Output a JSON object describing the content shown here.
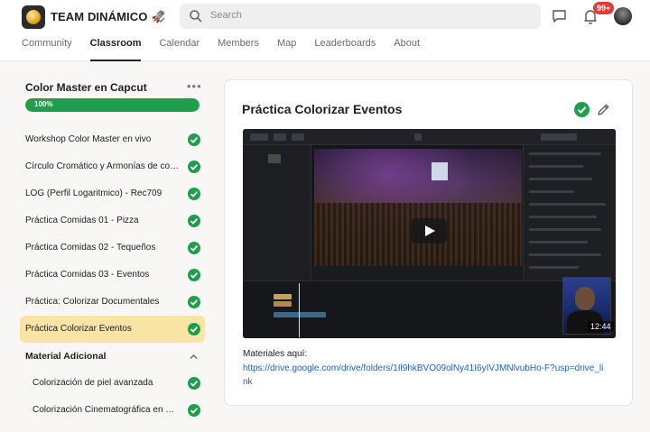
{
  "header": {
    "team_name": "TEAM DINÁMICO",
    "team_emoji": "🚀",
    "search_placeholder": "Search",
    "notification_count": "99+",
    "tabs": [
      {
        "label": "Community",
        "active": false
      },
      {
        "label": "Classroom",
        "active": true
      },
      {
        "label": "Calendar",
        "active": false
      },
      {
        "label": "Members",
        "active": false
      },
      {
        "label": "Map",
        "active": false
      },
      {
        "label": "Leaderboards",
        "active": false
      },
      {
        "label": "About",
        "active": false
      }
    ]
  },
  "sidebar": {
    "course_title": "Color Master en Capcut",
    "progress": 100,
    "progress_label": "100%",
    "lessons": [
      {
        "label": "Workshop Color Master en vivo",
        "completed": true,
        "active": false
      },
      {
        "label": "Círculo Cromático y Armonías de colores",
        "completed": true,
        "active": false
      },
      {
        "label": "LOG (Perfil Logaritmico) - Rec709",
        "completed": true,
        "active": false
      },
      {
        "label": "Práctica Comidas 01 - Pizza",
        "completed": true,
        "active": false
      },
      {
        "label": "Práctica Comidas 02 - Tequeños",
        "completed": true,
        "active": false
      },
      {
        "label": "Práctica Comidas 03 - Eventos",
        "completed": true,
        "active": false
      },
      {
        "label": "Práctica: Colorizar Documentales",
        "completed": true,
        "active": false
      },
      {
        "label": "Práctica Colorizar Eventos",
        "completed": true,
        "active": true
      }
    ],
    "section": {
      "title": "Material Adicional",
      "expanded": true,
      "lessons": [
        {
          "label": "Colorización de piel avanzada",
          "completed": true
        },
        {
          "label": "Colorización Cinematográfica en Capcut",
          "completed": true
        }
      ]
    }
  },
  "content": {
    "title": "Práctica Colorizar Eventos",
    "completed": true,
    "video": {
      "duration": "12:44"
    },
    "materials_label": "Materiales aquí:",
    "materials_link": "https://drive.google.com/drive/folders/1Il9hkBVO09olNy41I6yIVJMNlvubHo-F?usp=drive_link"
  },
  "colors": {
    "accent_green": "#1f9f4d",
    "active_lesson_bg": "#f9e4a5",
    "link_blue": "#1a63d0",
    "badge_red": "#e53935"
  }
}
